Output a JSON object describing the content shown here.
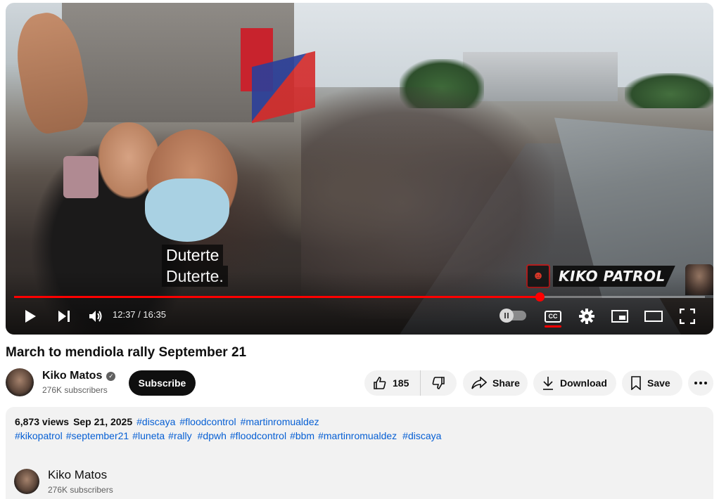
{
  "player": {
    "caption_lines": [
      "Duterte",
      "Duterte."
    ],
    "watermark_text": "KIKO PATROL",
    "time_current": "12:37",
    "time_separator": " / ",
    "time_total": "16:35",
    "progress_fraction": 0.7603,
    "cc_label": "CC",
    "icons": [
      "play-icon",
      "next-icon",
      "volume-icon",
      "autoplay-toggle",
      "cc-icon",
      "settings-icon",
      "miniplayer-icon",
      "theater-icon",
      "fullscreen-icon"
    ],
    "accent_color": "#ff0000"
  },
  "video": {
    "title": "March to mendiola rally September 21"
  },
  "channel": {
    "name": "Kiko Matos",
    "subscribers": "276K subscribers",
    "subscribe_label": "Subscribe"
  },
  "actions": {
    "like_count": "185",
    "share_label": "Share",
    "download_label": "Download",
    "save_label": "Save"
  },
  "description": {
    "views": "6,873 views",
    "date": "Sep 21, 2025",
    "tags_row1": [
      "#discaya",
      "#floodcontrol",
      "#martinromualdez"
    ],
    "tags_row2": [
      "#kikopatrol",
      "#september21",
      "#luneta",
      "#rally",
      "#dpwh",
      "#floodcontrol",
      "#bbm",
      "#martinromualdez",
      "#discaya"
    ],
    "channel_name": "Kiko Matos",
    "channel_subscribers": "276K subscribers"
  },
  "colors": {
    "link": "#065fd4",
    "subscribe_bg": "#0f0f0f",
    "pill_bg": "#f2f2f2"
  }
}
